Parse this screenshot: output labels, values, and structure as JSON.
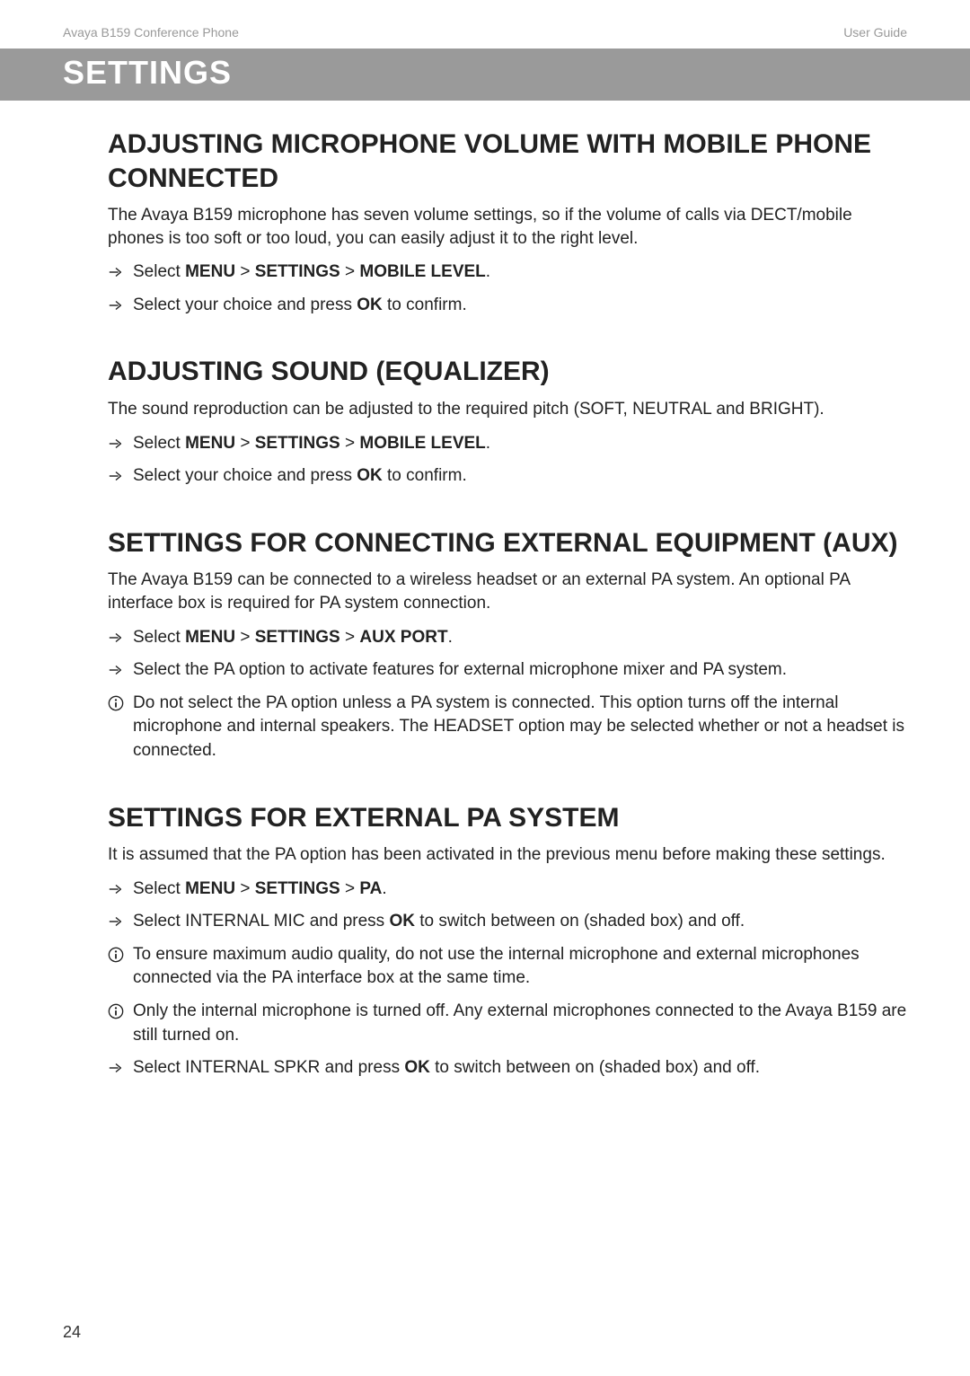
{
  "header": {
    "left": "Avaya B159 Conference Phone",
    "right": "User Guide"
  },
  "titleBar": "SETTINGS",
  "sections": [
    {
      "heading": "ADJUSTING MICROPHONE VOLUME WITH MOBILE PHONE CONNECTED",
      "intro": "The Avaya B159 microphone has seven volume settings, so if the volume of calls via DECT/mobile phones is too soft or too loud, you can easily adjust it to the right level.",
      "items": [
        {
          "type": "arrow",
          "html": "Select <span class='bold'>MENU</span> > <span class='bold'>SETTINGS</span> > <span class='bold'>MOBILE LEVEL</span>."
        },
        {
          "type": "arrow",
          "html": "Select your choice and press <span class='bold'>OK</span> to confirm."
        }
      ]
    },
    {
      "heading": "ADJUSTING SOUND (EQUALIZER)",
      "intro": "The sound reproduction can be adjusted to the required pitch (SOFT, NEUTRAL and BRIGHT).",
      "items": [
        {
          "type": "arrow",
          "html": "Select <span class='bold'>MENU</span> > <span class='bold'>SETTINGS</span> > <span class='bold'>MOBILE LEVEL</span>."
        },
        {
          "type": "arrow",
          "html": "Select your choice and press <span class='bold'>OK</span> to confirm."
        }
      ]
    },
    {
      "heading": "SETTINGS FOR CONNECTING EXTERNAL EQUIPMENT (AUX)",
      "intro": "The Avaya B159 can be connected to a wireless headset or an external PA system. An optional PA interface box is required for PA system connection.",
      "items": [
        {
          "type": "arrow",
          "html": "Select <span class='bold'>MENU</span> > <span class='bold'>SETTINGS</span> > <span class='bold'>AUX PORT</span>."
        },
        {
          "type": "arrow",
          "html": "Select the PA option to activate features for external microphone mixer and PA system."
        },
        {
          "type": "info",
          "html": "Do not select the PA option unless a PA system is connected. This option turns off the internal microphone and internal speakers. The HEADSET option may be selected whether or not a headset is connected."
        }
      ]
    },
    {
      "heading": "SETTINGS FOR EXTERNAL PA SYSTEM",
      "intro": "It is assumed that the PA option has been activated in the previous menu before making these settings.",
      "items": [
        {
          "type": "arrow",
          "html": "Select <span class='bold'>MENU</span> > <span class='bold'>SETTINGS</span> > <span class='bold'>PA</span>."
        },
        {
          "type": "arrow",
          "html": "Select INTERNAL MIC and press <span class='bold'>OK</span> to switch between on (shaded box) and off."
        },
        {
          "type": "info",
          "html": "To ensure maximum audio quality, do not use the internal microphone and external microphones connected via the PA interface box at the same time."
        },
        {
          "type": "info",
          "html": "Only the internal microphone is turned off. Any external microphones connected to the Avaya B159 are still turned on."
        },
        {
          "type": "arrow",
          "html": "Select INTERNAL SPKR and press <span class='bold'>OK</span> to switch between on (shaded box) and off."
        }
      ]
    }
  ],
  "pageNumber": "24"
}
